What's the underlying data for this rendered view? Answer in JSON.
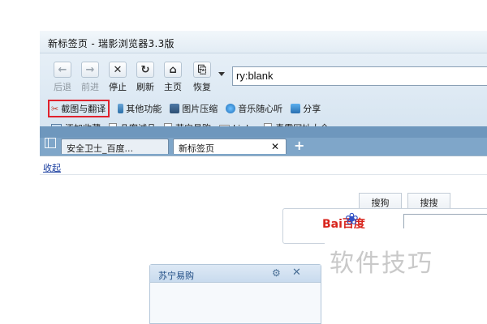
{
  "window": {
    "title": "新标签页 - 瑞影浏览器3.3版"
  },
  "nav": {
    "back": {
      "icon": "back-arrow-icon",
      "label": "后退"
    },
    "forward": {
      "icon": "forward-arrow-icon",
      "label": "前进"
    },
    "stop": {
      "icon": "stop-icon",
      "label": "停止"
    },
    "refresh": {
      "icon": "refresh-icon",
      "label": "刷新"
    },
    "home": {
      "icon": "home-icon",
      "label": "主页"
    },
    "restore": {
      "icon": "restore-icon",
      "label": "恢复"
    }
  },
  "address": {
    "value": "ry:blank"
  },
  "tools": [
    {
      "label": "截图与翻译",
      "icon": "scissors-icon"
    },
    {
      "label": "其他功能",
      "icon": "tuning-fork-icon"
    },
    {
      "label": "图片压缩",
      "icon": "image-compress-icon"
    },
    {
      "label": "音乐随心听",
      "icon": "music-icon"
    },
    {
      "label": "分享",
      "icon": "share-icon"
    }
  ],
  "favorites": [
    {
      "label": "添加收藏",
      "icon": "add-favorite-icon"
    },
    {
      "label": "凡客诚品",
      "icon": "page-icon"
    },
    {
      "label": "苏宁易购",
      "icon": "page-icon"
    },
    {
      "label": "Links",
      "icon": "folder-icon"
    },
    {
      "label": "毒霸网址大全",
      "icon": "page-icon"
    }
  ],
  "tabs": [
    {
      "label": "安全卫士_百度..."
    },
    {
      "label": "新标签页",
      "close": "✕"
    }
  ],
  "newtab": "+",
  "content": {
    "collapse": "收起",
    "search_tabs": [
      "搜狗",
      "搜搜"
    ],
    "baidu_logo_text": "Bai",
    "baidu_logo_cn": "百度"
  },
  "suning_widget": {
    "title": "苏宁易购",
    "gear": "⚙",
    "close": "✕"
  },
  "watermark": "软件技巧",
  "colors": {
    "highlight_border": "#e0222d",
    "tabbar": "#7fa6c9",
    "link": "#1b3fa0"
  }
}
